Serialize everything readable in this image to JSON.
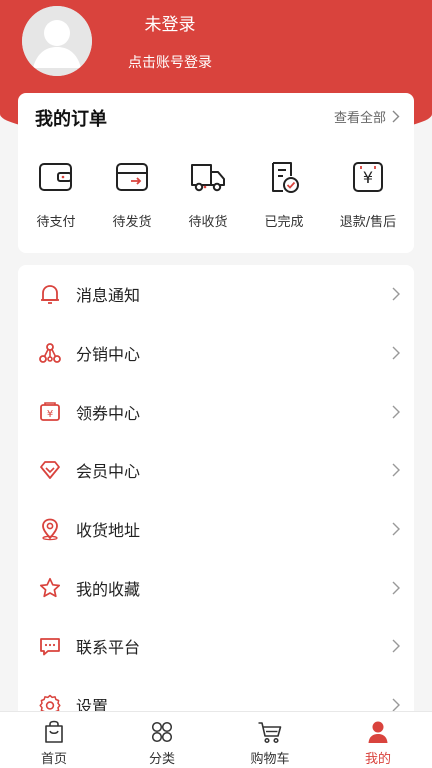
{
  "theme": {
    "accent": "#d9433d",
    "background": "#f5f5f5"
  },
  "profile": {
    "avatar_icon": "default-avatar-icon",
    "login_status": "未登录",
    "login_hint": "点击账号登录"
  },
  "orders": {
    "title": "我的订单",
    "view_all": "查看全部",
    "items": [
      {
        "label": "待支付",
        "icon": "wallet-icon"
      },
      {
        "label": "待发货",
        "icon": "box-icon"
      },
      {
        "label": "待收货",
        "icon": "truck-icon"
      },
      {
        "label": "已完成",
        "icon": "completed-doc-icon"
      },
      {
        "label": "退款/售后",
        "icon": "refund-icon"
      }
    ]
  },
  "menu": {
    "items": [
      {
        "label": "消息通知",
        "icon": "bell-icon"
      },
      {
        "label": "分销中心",
        "icon": "network-icon"
      },
      {
        "label": "领券中心",
        "icon": "coupon-icon"
      },
      {
        "label": "会员中心",
        "icon": "diamond-icon"
      },
      {
        "label": "收货地址",
        "icon": "location-icon"
      },
      {
        "label": "我的收藏",
        "icon": "star-icon"
      },
      {
        "label": "联系平台",
        "icon": "chat-icon"
      },
      {
        "label": "设置",
        "icon": "gear-icon"
      }
    ]
  },
  "tabbar": {
    "active_index": 3,
    "items": [
      {
        "label": "首页",
        "icon": "home-bag-icon"
      },
      {
        "label": "分类",
        "icon": "category-icon"
      },
      {
        "label": "购物车",
        "icon": "cart-icon"
      },
      {
        "label": "我的",
        "icon": "user-icon"
      }
    ]
  }
}
